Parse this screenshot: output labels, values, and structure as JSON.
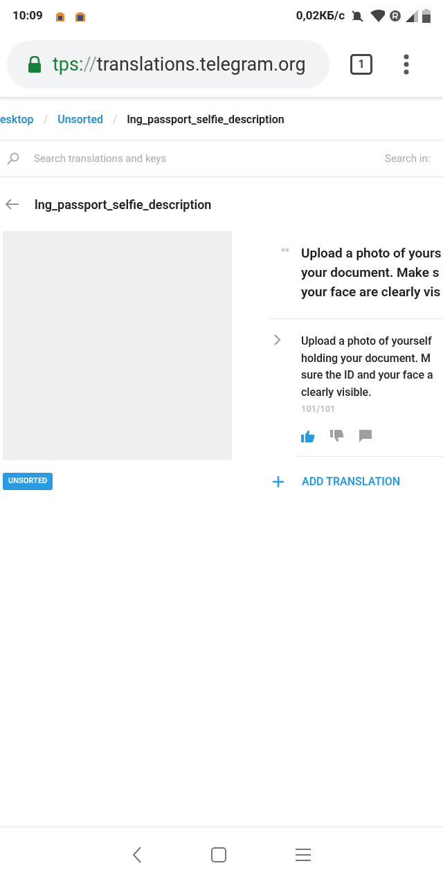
{
  "status_bar": {
    "time": "10:09",
    "speed": "0,02КБ/с"
  },
  "browser": {
    "url_scheme": "tps:",
    "url_separator": "//",
    "url_host": "translations.telegram.org",
    "tab_count": "1"
  },
  "breadcrumbs": [
    {
      "label": "esktop",
      "link": true
    },
    {
      "separator": "/",
      "label": "Unsorted",
      "link": true
    },
    {
      "separator": "/",
      "label": "lng_passport_selfie_description",
      "link": false
    }
  ],
  "search": {
    "placeholder": "Search translations and keys",
    "search_in_label": "Search in:"
  },
  "key_title": "lng_passport_selfie_description",
  "badge": "UNSORTED",
  "source_text_lines": [
    "Upload a photo of yours",
    "your document. Make s",
    "your face are clearly vis"
  ],
  "translation": {
    "lines": [
      "Upload a photo of yourself",
      "holding your document. M",
      "sure the ID and your face a",
      "clearly visible."
    ],
    "count": "101/101",
    "votes": [
      {
        "kind": "up",
        "selected": true
      },
      {
        "kind": "down",
        "selected": false
      },
      {
        "kind": "comment",
        "selected": false
      }
    ]
  },
  "add_translation": "ADD TRANSLATION"
}
